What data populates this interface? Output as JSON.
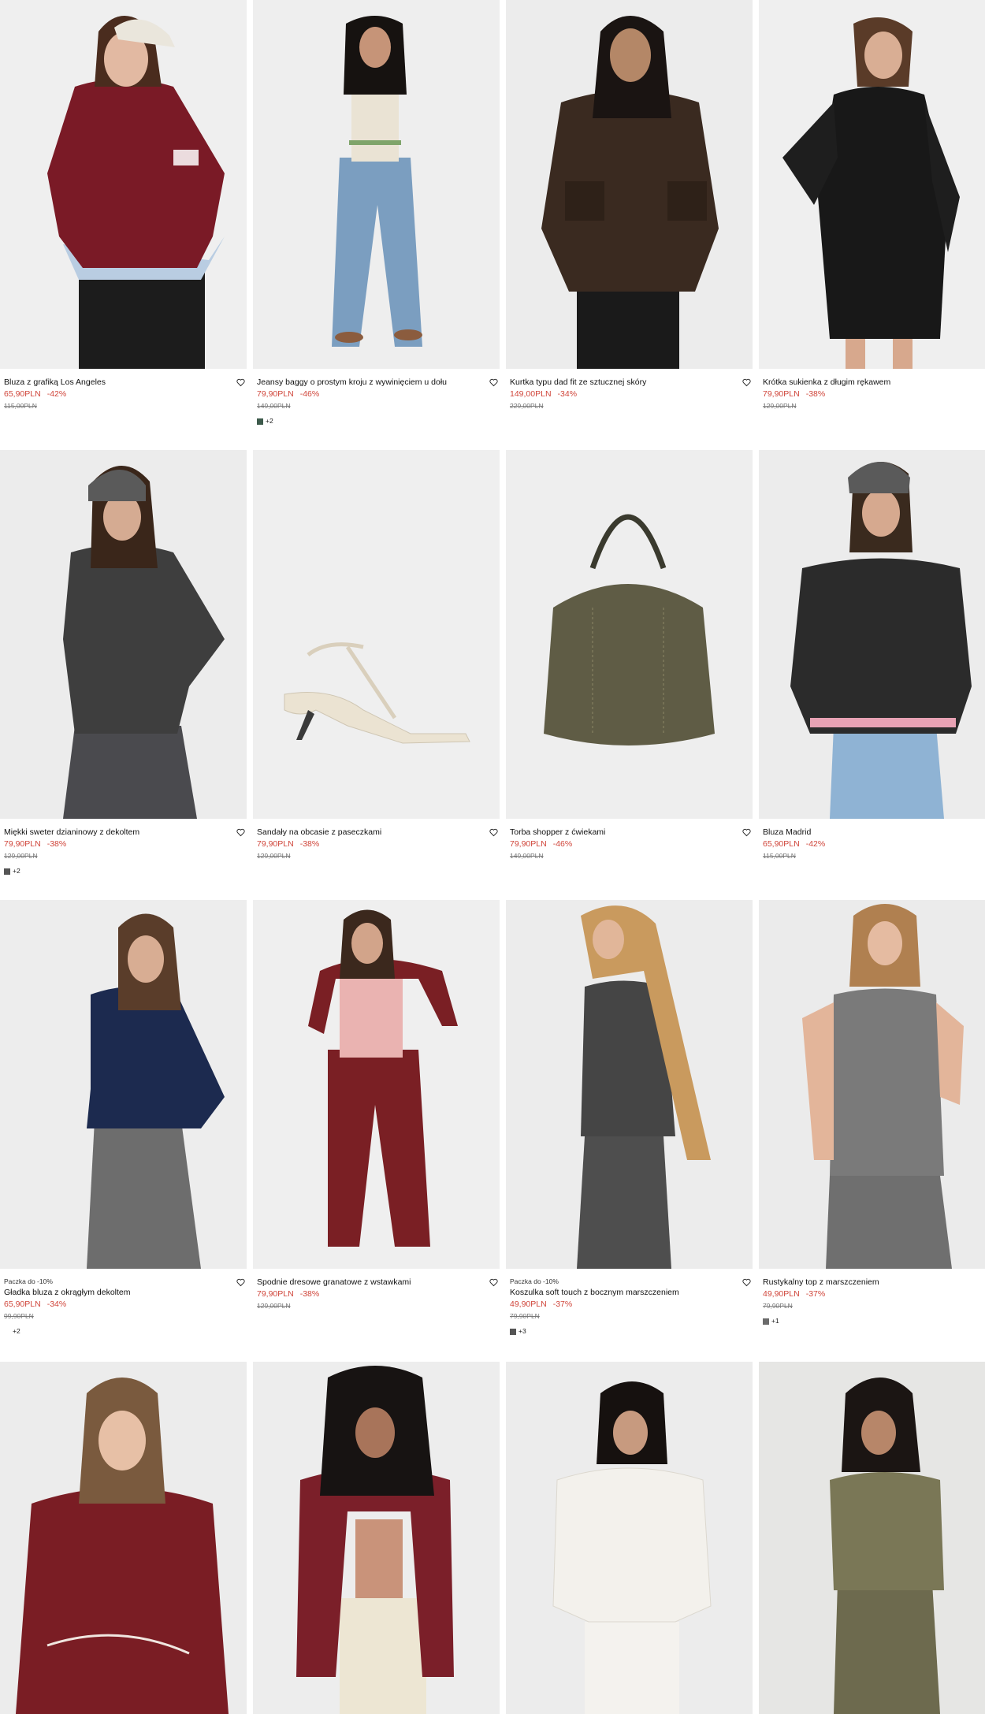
{
  "products": [
    {
      "name": "Bluza z grafiką Los Angeles",
      "price": "65,90PLN",
      "discount": "-42%",
      "old_price": "115,00PLN",
      "tag": "",
      "swatch_more": "",
      "swatch_color": ""
    },
    {
      "name": "Jeansy baggy o prostym kroju z wywinięciem u dołu",
      "price": "79,90PLN",
      "discount": "-46%",
      "old_price": "149,00PLN",
      "tag": "",
      "swatch_more": "+2",
      "swatch_color": "#3d5a4b"
    },
    {
      "name": "Kurtka typu dad fit ze sztucznej skóry",
      "price": "149,00PLN",
      "discount": "-34%",
      "old_price": "229,00PLN",
      "tag": "",
      "swatch_more": "",
      "swatch_color": ""
    },
    {
      "name": "Krótka sukienka z długim rękawem",
      "price": "79,90PLN",
      "discount": "-38%",
      "old_price": "129,00PLN",
      "tag": "",
      "swatch_more": "",
      "swatch_color": ""
    },
    {
      "name": "Miękki sweter dzianinowy z dekoltem",
      "price": "79,90PLN",
      "discount": "-38%",
      "old_price": "129,00PLN",
      "tag": "",
      "swatch_more": "+2",
      "swatch_color": "#555555"
    },
    {
      "name": "Sandały na obcasie z paseczkami",
      "price": "79,90PLN",
      "discount": "-38%",
      "old_price": "129,00PLN",
      "tag": "",
      "swatch_more": "",
      "swatch_color": ""
    },
    {
      "name": "Torba shopper z ćwiekami",
      "price": "79,90PLN",
      "discount": "-46%",
      "old_price": "149,00PLN",
      "tag": "",
      "swatch_more": "",
      "swatch_color": ""
    },
    {
      "name": "Bluza Madrid",
      "price": "65,90PLN",
      "discount": "-42%",
      "old_price": "115,00PLN",
      "tag": "",
      "swatch_more": "",
      "swatch_color": ""
    },
    {
      "name": "Gładka bluza z okrągłym dekoltem",
      "price": "65,90PLN",
      "discount": "-34%",
      "old_price": "99,90PLN",
      "tag": "Paczka do -10%",
      "swatch_more": "+2",
      "swatch_color": ""
    },
    {
      "name": "Spodnie dresowe granatowe z wstawkami",
      "price": "79,90PLN",
      "discount": "-38%",
      "old_price": "129,00PLN",
      "tag": "",
      "swatch_more": "",
      "swatch_color": ""
    },
    {
      "name": "Koszulka soft touch z bocznym marszczeniem",
      "price": "49,90PLN",
      "discount": "-37%",
      "old_price": "79,90PLN",
      "tag": "Paczka do -10%",
      "swatch_more": "+3",
      "swatch_color": "#555555"
    },
    {
      "name": "Rustykalny top z marszczeniem",
      "price": "49,90PLN",
      "discount": "-37%",
      "old_price": "79,90PLN",
      "tag": "",
      "swatch_more": "+1",
      "swatch_color": "#6b6b6b"
    },
    {
      "name": "",
      "price": "",
      "discount": "",
      "old_price": "",
      "tag": "",
      "swatch_more": "",
      "swatch_color": ""
    },
    {
      "name": "",
      "price": "",
      "discount": "",
      "old_price": "",
      "tag": "",
      "swatch_more": "",
      "swatch_color": ""
    },
    {
      "name": "",
      "price": "",
      "discount": "",
      "old_price": "",
      "tag": "",
      "swatch_more": "",
      "swatch_color": ""
    },
    {
      "name": "",
      "price": "",
      "discount": "",
      "old_price": "",
      "tag": "",
      "swatch_more": "",
      "swatch_color": ""
    }
  ],
  "colors": {
    "sale_red": "#d0453a",
    "image_bg": "#ececec"
  }
}
